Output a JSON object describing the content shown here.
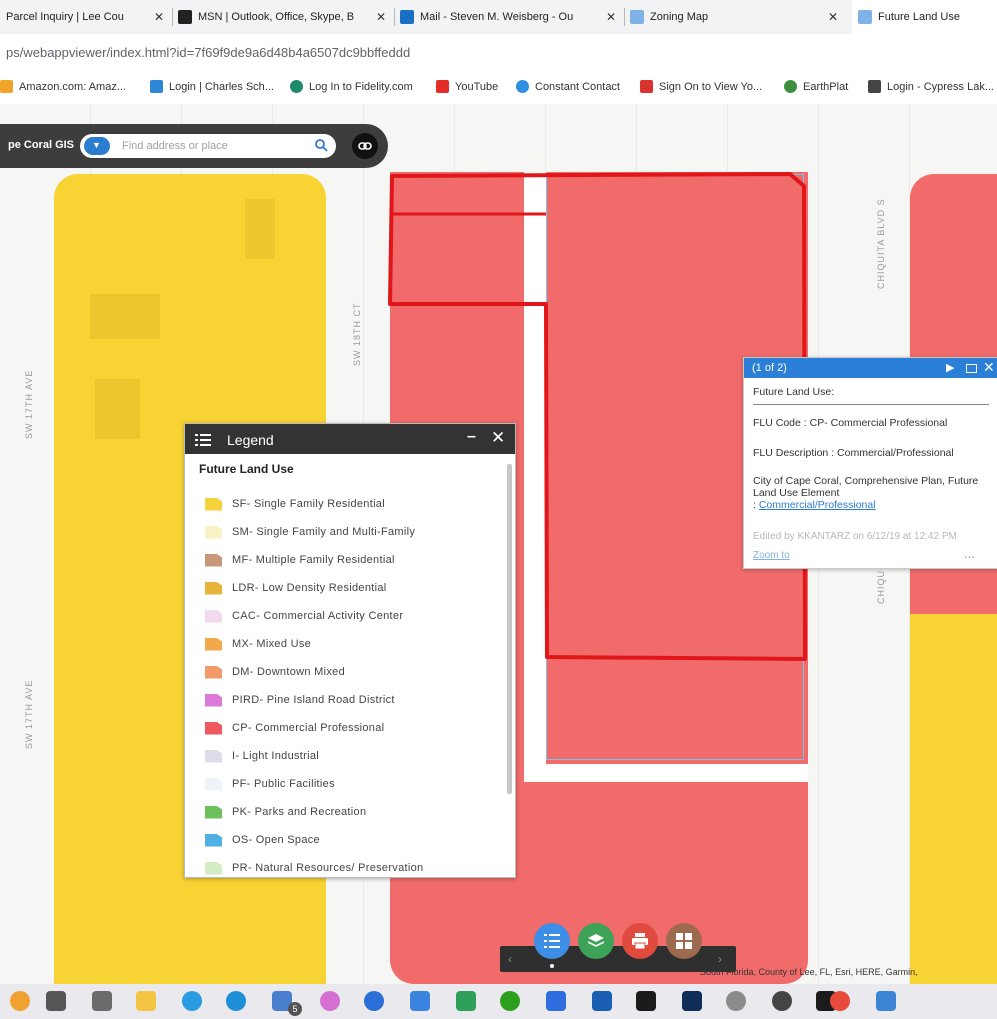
{
  "browser": {
    "tabs": [
      {
        "title": "Parcel Inquiry | Lee Cou"
      },
      {
        "title": "MSN | Outlook, Office, Skype, B"
      },
      {
        "title": "Mail - Steven M. Weisberg - Ou"
      },
      {
        "title": "Zoning Map"
      },
      {
        "title": "Future Land Use"
      }
    ],
    "url": "ps/webappviewer/index.html?id=7f69f9de9a6d48b4a6507dc9bbffeddd",
    "bookmarks": [
      "Amazon.com: Amaz...",
      "Login | Charles Sch...",
      "Log In to Fidelity.com",
      "YouTube",
      "Constant Contact",
      "Sign On to View Yo...",
      "EarthPlat",
      "Login - Cypress Lak..."
    ]
  },
  "toolbar": {
    "app_title": "pe Coral GIS",
    "search_placeholder": "Find address or place"
  },
  "map": {
    "streets": [
      "SW 17TH AVE",
      "SW 18TH CT",
      "CHIQUITA BLVD S",
      "SW 17TH AVE",
      "CHIQU"
    ],
    "colors": {
      "residential": "#f7d333",
      "commercial": "#f16b6b",
      "selection": "#e0161b",
      "outline": "#7ec1e6"
    }
  },
  "legend": {
    "title": "Legend",
    "subtitle": "Future Land Use",
    "items": [
      {
        "label": "SF- Single Family Residential",
        "color": "#f6d33a"
      },
      {
        "label": "SM- Single Family and Multi-Family",
        "color": "#f7f3c5"
      },
      {
        "label": "MF- Multiple Family Residential",
        "color": "#c8977a"
      },
      {
        "label": "LDR- Low Density Residential",
        "color": "#e8b43a"
      },
      {
        "label": "CAC- Commercial Activity Center",
        "color": "#f2d9ee"
      },
      {
        "label": "MX- Mixed Use",
        "color": "#f2a94c"
      },
      {
        "label": "DM- Downtown Mixed",
        "color": "#f29a6a"
      },
      {
        "label": "PIRD- Pine Island Road District",
        "color": "#dd79d8"
      },
      {
        "label": "CP- Commercial Professional",
        "color": "#ee5a5f"
      },
      {
        "label": "I- Light Industrial",
        "color": "#dcdce6"
      },
      {
        "label": "PF- Public Facilities",
        "color": "#eef4f8"
      },
      {
        "label": "PK- Parks and Recreation",
        "color": "#6cc15a"
      },
      {
        "label": "OS- Open Space",
        "color": "#4fb0e2"
      },
      {
        "label": "PR- Natural Resources/ Preservation",
        "color": "#d3ecc4"
      }
    ]
  },
  "popup": {
    "count": "(1 of 2)",
    "title": "Future Land Use:",
    "flu_code": "FLU Code : CP- Commercial Professional",
    "flu_description": "FLU Description : Commercial/Professional",
    "plan_text": "City of Cape Coral, Comprehensive Plan, Future Land Use Element",
    "plan_link_prefix": ": ",
    "plan_link": "Commercial/Professional",
    "edited": "Edited by KKANTARZ on 6/12/19 at 12:42 PM",
    "zoom": "Zoom to",
    "more": "..."
  },
  "attribution": "South Florida, County of Lee, FL, Esri, HERE, Garmin,",
  "taskbar": {
    "badge": "5"
  }
}
